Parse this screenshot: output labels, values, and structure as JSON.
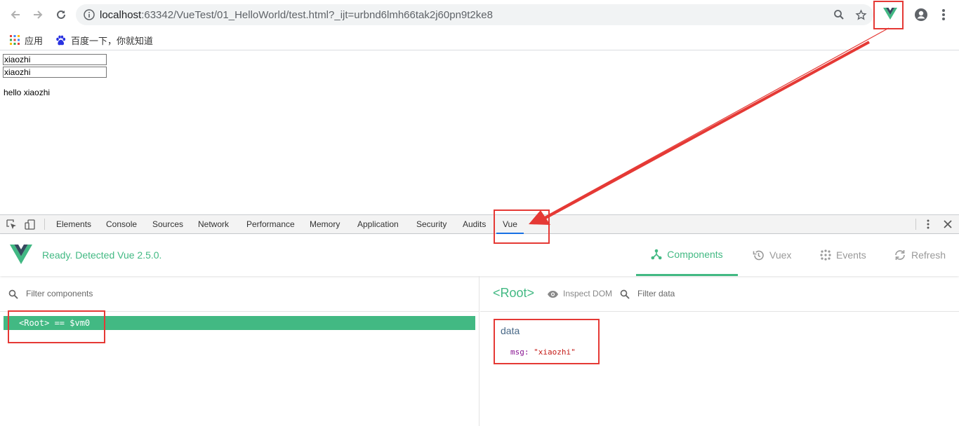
{
  "browser": {
    "url_host": "localhost",
    "url_rest": ":63342/VueTest/01_HelloWorld/test.html?_ijt=urbnd6lmh66tak2j60pn9t2ke8",
    "bookmarks": [
      {
        "label": "应用",
        "icon": "apps-grid-icon"
      },
      {
        "label": "百度一下，你就知道",
        "icon": "baidu-paw-icon"
      }
    ]
  },
  "page": {
    "input1_value": "xiaozhi",
    "input2_value": "xiaozhi",
    "hello_text": "hello xiaozhi"
  },
  "devtools": {
    "tabs": [
      "Elements",
      "Console",
      "Sources",
      "Network",
      "Performance",
      "Memory",
      "Application",
      "Security",
      "Audits",
      "Vue"
    ],
    "active_tab": "Vue"
  },
  "vue_devtools": {
    "ready_text": "Ready. Detected Vue 2.5.0.",
    "nav": [
      {
        "label": "Components",
        "icon": "components-icon",
        "active": true
      },
      {
        "label": "Vuex",
        "icon": "history-icon",
        "active": false
      },
      {
        "label": "Events",
        "icon": "events-icon",
        "active": false
      },
      {
        "label": "Refresh",
        "icon": "refresh-icon",
        "active": false
      }
    ],
    "filter_components_placeholder": "Filter components",
    "root_row": "<Root> == $vm0",
    "root_title": "<Root>",
    "inspect_dom": "Inspect DOM",
    "filter_data_placeholder": "Filter data",
    "data_section": "data",
    "data_key": "msg",
    "data_value": "\"xiaozhi\""
  },
  "colors": {
    "vue_green": "#42b983",
    "annotation_red": "#e53935",
    "active_tab_blue": "#1a73e8"
  }
}
